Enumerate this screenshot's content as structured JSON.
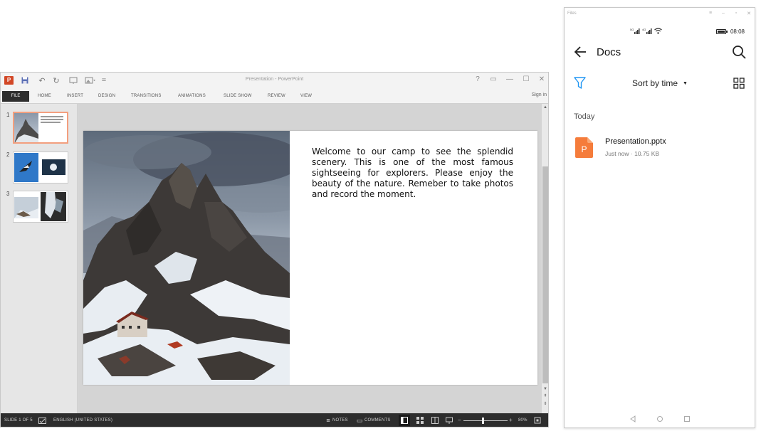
{
  "powerpoint": {
    "window_title": "Presentation - PowerPoint",
    "logo_letter": "P",
    "window_buttons": {
      "help": "?",
      "minimize": "—",
      "restore": "☐",
      "close": "✕"
    },
    "file_tab": "FILE",
    "tabs": [
      "HOME",
      "INSERT",
      "DESIGN",
      "TRANSITIONS",
      "ANIMATIONS",
      "SLIDE SHOW",
      "REVIEW",
      "VIEW"
    ],
    "sign_in": "Sign in",
    "thumbnails": [
      {
        "number": "1",
        "selected": true
      },
      {
        "number": "2",
        "selected": false
      },
      {
        "number": "3",
        "selected": false
      }
    ],
    "slide": {
      "body_text": "Welcome to our camp to see the  splendid scenery. This is one of the most famous sightseeing for explorers. Please enjoy the beauty of the nature. Remeber to take photos and record the moment."
    },
    "status": {
      "slide_info": "SLIDE 1 OF 5",
      "language": "ENGLISH (UNITED STATES)",
      "notes": "NOTES",
      "comments": "COMMENTS",
      "zoom": "80%"
    },
    "colors": {
      "accent": "#d24726",
      "thumb_selected": "#f39f7e",
      "statusbar": "#2d2d2d"
    }
  },
  "phone": {
    "app_name": "Files",
    "status_bar": {
      "signal_1": "5G",
      "signal_2": "4G",
      "time": "08:08"
    },
    "header": {
      "title": "Docs"
    },
    "toolbar": {
      "sort_label": "Sort by time",
      "sort_caret": "▼"
    },
    "section_label": "Today",
    "files": [
      {
        "name": "Presentation.pptx",
        "meta": "Just now · 10.75 KB",
        "icon_letter": "P",
        "icon_color": "#f57c3b"
      }
    ],
    "icons": {
      "back": "back-arrow-icon",
      "search": "search-icon",
      "filter": "filter-icon",
      "grid": "grid-view-icon"
    },
    "colors": {
      "accent": "#2196f3",
      "pptx_icon": "#f57c3b"
    }
  }
}
